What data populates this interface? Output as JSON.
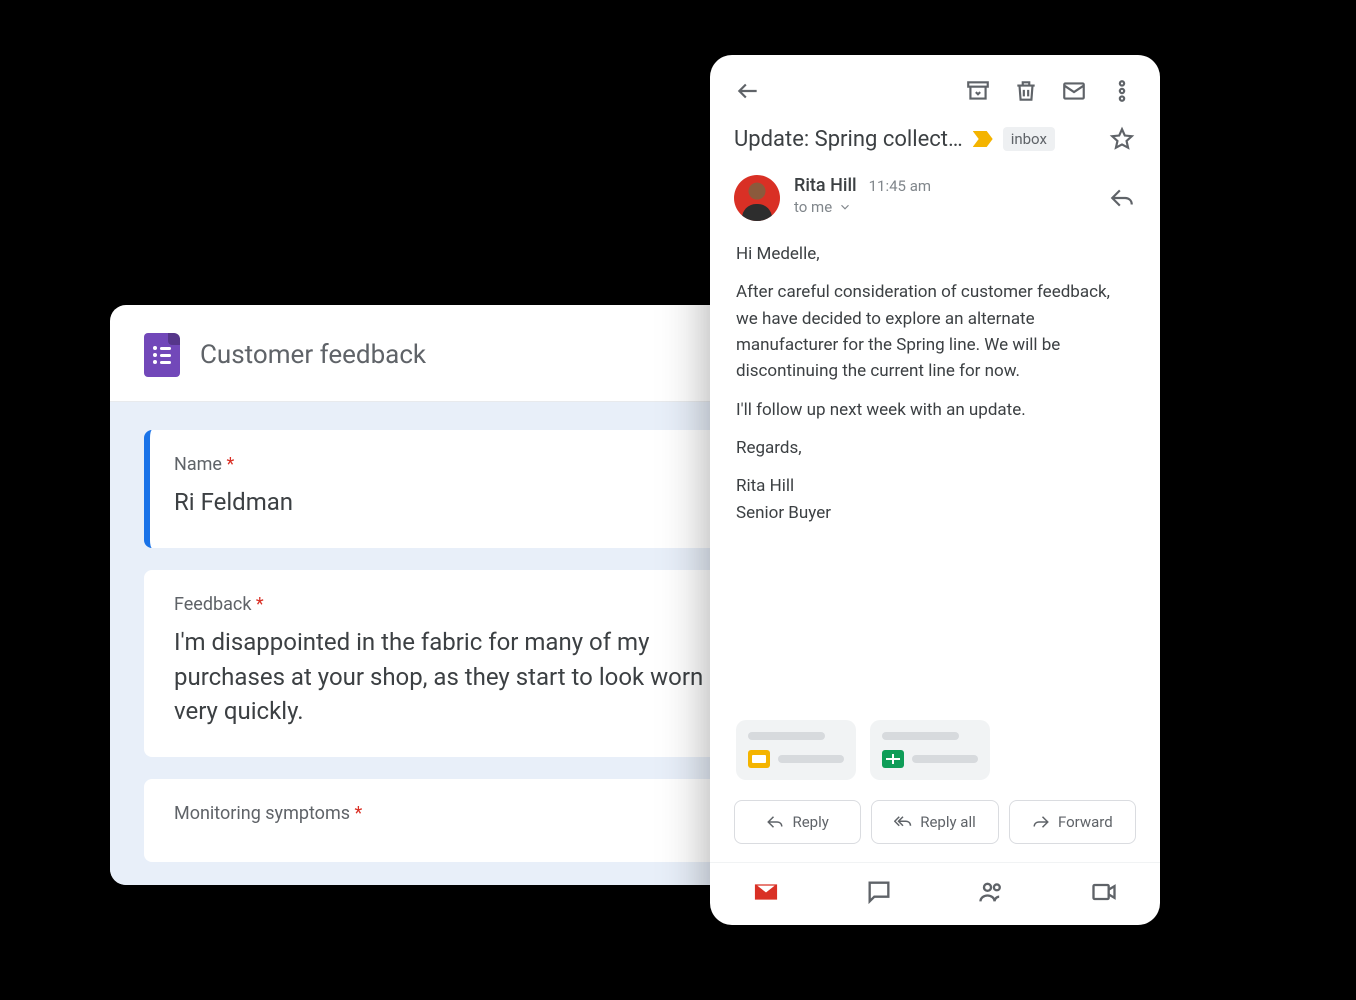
{
  "forms": {
    "title": "Customer feedback",
    "questions": [
      {
        "label": "Name",
        "required": true,
        "value": "Ri Feldman"
      },
      {
        "label": "Feedback",
        "required": true,
        "value": "I'm disappointed in the fabric for many of my purchases at your shop, as they start to look worn very quickly."
      },
      {
        "label": "Monitoring symptoms",
        "required": true,
        "value": ""
      }
    ]
  },
  "gmail": {
    "subject": "Update: Spring collect…",
    "inbox_chip": "inbox",
    "sender": {
      "name": "Rita Hill",
      "time": "11:45 am",
      "to": "to me"
    },
    "body": {
      "greeting": "Hi Medelle,",
      "p1": "After careful consideration of customer feedback, we have decided to explore an alternate manufacturer for the Spring line. We will be discontinuing the current line for now.",
      "p2": "I'll follow up next week with an update.",
      "closing": "Regards,",
      "sig_name": "Rita Hill",
      "sig_title": "Senior Buyer"
    },
    "actions": {
      "reply": "Reply",
      "reply_all": "Reply all",
      "forward": "Forward"
    }
  }
}
